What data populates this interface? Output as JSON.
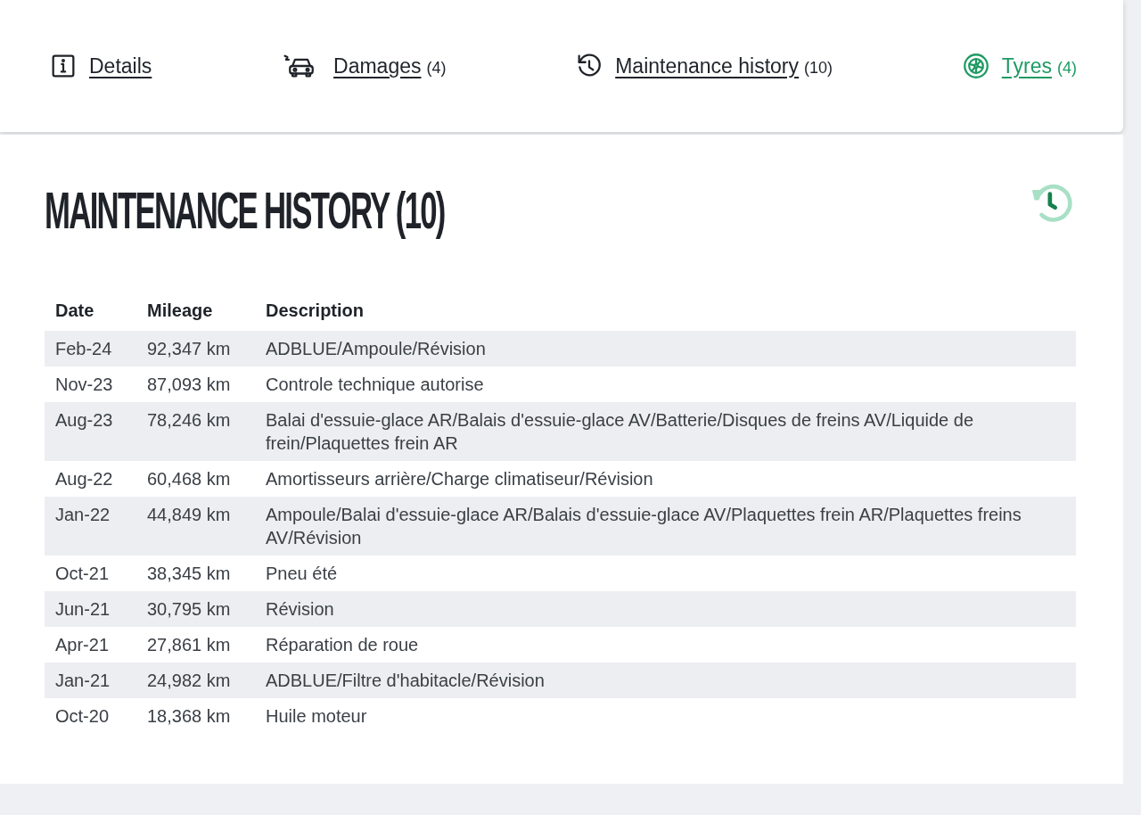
{
  "tabs": [
    {
      "kind": "info",
      "label": "Details",
      "selected": false
    },
    {
      "kind": "damage",
      "label": "Damages",
      "count": "(4)",
      "selected": false
    },
    {
      "kind": "history",
      "label": "Maintenance history",
      "count": "(10)",
      "selected": false
    },
    {
      "kind": "tyre",
      "label": "Tyres",
      "count": "(4)",
      "selected": true
    }
  ],
  "section": {
    "title": "MAINTENANCE HISTORY (10)"
  },
  "table": {
    "columns": [
      "Date",
      "Mileage",
      "Description"
    ],
    "rows": [
      [
        "Feb-24",
        "92,347 km",
        "ADBLUE/Ampoule/Révision"
      ],
      [
        "Nov-23",
        "87,093 km",
        "Controle technique autorise"
      ],
      [
        "Aug-23",
        "78,246 km",
        "Balai d'essuie-glace AR/Balais d'essuie-glace AV/Batterie/Disques de freins AV/Liquide de frein/Plaquettes frein AR"
      ],
      [
        "Aug-22",
        "60,468 km",
        "Amortisseurs arrière/Charge climatiseur/Révision"
      ],
      [
        "Jan-22",
        "44,849 km",
        "Ampoule/Balai d'essuie-glace AR/Balais d'essuie-glace AV/Plaquettes frein AR/Plaquettes freins AV/Révision"
      ],
      [
        "Oct-21",
        "38,345 km",
        "Pneu été"
      ],
      [
        "Jun-21",
        "30,795 km",
        "Révision"
      ],
      [
        "Apr-21",
        "27,861 km",
        "Réparation de roue"
      ],
      [
        "Jan-21",
        "24,982 km",
        "ADBLUE/Filtre d'habitacle/Révision"
      ],
      [
        "Oct-20",
        "18,368 km",
        "Huile moteur"
      ]
    ]
  }
}
